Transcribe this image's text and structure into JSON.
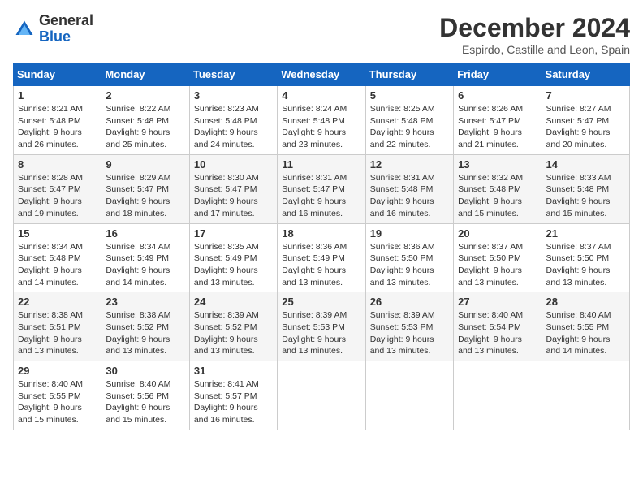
{
  "header": {
    "logo_general": "General",
    "logo_blue": "Blue",
    "month_title": "December 2024",
    "location": "Espirdo, Castille and Leon, Spain"
  },
  "columns": [
    "Sunday",
    "Monday",
    "Tuesday",
    "Wednesday",
    "Thursday",
    "Friday",
    "Saturday"
  ],
  "weeks": [
    [
      {
        "day": "1",
        "sunrise": "Sunrise: 8:21 AM",
        "sunset": "Sunset: 5:48 PM",
        "daylight": "Daylight: 9 hours and 26 minutes."
      },
      {
        "day": "2",
        "sunrise": "Sunrise: 8:22 AM",
        "sunset": "Sunset: 5:48 PM",
        "daylight": "Daylight: 9 hours and 25 minutes."
      },
      {
        "day": "3",
        "sunrise": "Sunrise: 8:23 AM",
        "sunset": "Sunset: 5:48 PM",
        "daylight": "Daylight: 9 hours and 24 minutes."
      },
      {
        "day": "4",
        "sunrise": "Sunrise: 8:24 AM",
        "sunset": "Sunset: 5:48 PM",
        "daylight": "Daylight: 9 hours and 23 minutes."
      },
      {
        "day": "5",
        "sunrise": "Sunrise: 8:25 AM",
        "sunset": "Sunset: 5:48 PM",
        "daylight": "Daylight: 9 hours and 22 minutes."
      },
      {
        "day": "6",
        "sunrise": "Sunrise: 8:26 AM",
        "sunset": "Sunset: 5:47 PM",
        "daylight": "Daylight: 9 hours and 21 minutes."
      },
      {
        "day": "7",
        "sunrise": "Sunrise: 8:27 AM",
        "sunset": "Sunset: 5:47 PM",
        "daylight": "Daylight: 9 hours and 20 minutes."
      }
    ],
    [
      {
        "day": "8",
        "sunrise": "Sunrise: 8:28 AM",
        "sunset": "Sunset: 5:47 PM",
        "daylight": "Daylight: 9 hours and 19 minutes."
      },
      {
        "day": "9",
        "sunrise": "Sunrise: 8:29 AM",
        "sunset": "Sunset: 5:47 PM",
        "daylight": "Daylight: 9 hours and 18 minutes."
      },
      {
        "day": "10",
        "sunrise": "Sunrise: 8:30 AM",
        "sunset": "Sunset: 5:47 PM",
        "daylight": "Daylight: 9 hours and 17 minutes."
      },
      {
        "day": "11",
        "sunrise": "Sunrise: 8:31 AM",
        "sunset": "Sunset: 5:47 PM",
        "daylight": "Daylight: 9 hours and 16 minutes."
      },
      {
        "day": "12",
        "sunrise": "Sunrise: 8:31 AM",
        "sunset": "Sunset: 5:48 PM",
        "daylight": "Daylight: 9 hours and 16 minutes."
      },
      {
        "day": "13",
        "sunrise": "Sunrise: 8:32 AM",
        "sunset": "Sunset: 5:48 PM",
        "daylight": "Daylight: 9 hours and 15 minutes."
      },
      {
        "day": "14",
        "sunrise": "Sunrise: 8:33 AM",
        "sunset": "Sunset: 5:48 PM",
        "daylight": "Daylight: 9 hours and 15 minutes."
      }
    ],
    [
      {
        "day": "15",
        "sunrise": "Sunrise: 8:34 AM",
        "sunset": "Sunset: 5:48 PM",
        "daylight": "Daylight: 9 hours and 14 minutes."
      },
      {
        "day": "16",
        "sunrise": "Sunrise: 8:34 AM",
        "sunset": "Sunset: 5:49 PM",
        "daylight": "Daylight: 9 hours and 14 minutes."
      },
      {
        "day": "17",
        "sunrise": "Sunrise: 8:35 AM",
        "sunset": "Sunset: 5:49 PM",
        "daylight": "Daylight: 9 hours and 13 minutes."
      },
      {
        "day": "18",
        "sunrise": "Sunrise: 8:36 AM",
        "sunset": "Sunset: 5:49 PM",
        "daylight": "Daylight: 9 hours and 13 minutes."
      },
      {
        "day": "19",
        "sunrise": "Sunrise: 8:36 AM",
        "sunset": "Sunset: 5:50 PM",
        "daylight": "Daylight: 9 hours and 13 minutes."
      },
      {
        "day": "20",
        "sunrise": "Sunrise: 8:37 AM",
        "sunset": "Sunset: 5:50 PM",
        "daylight": "Daylight: 9 hours and 13 minutes."
      },
      {
        "day": "21",
        "sunrise": "Sunrise: 8:37 AM",
        "sunset": "Sunset: 5:50 PM",
        "daylight": "Daylight: 9 hours and 13 minutes."
      }
    ],
    [
      {
        "day": "22",
        "sunrise": "Sunrise: 8:38 AM",
        "sunset": "Sunset: 5:51 PM",
        "daylight": "Daylight: 9 hours and 13 minutes."
      },
      {
        "day": "23",
        "sunrise": "Sunrise: 8:38 AM",
        "sunset": "Sunset: 5:52 PM",
        "daylight": "Daylight: 9 hours and 13 minutes."
      },
      {
        "day": "24",
        "sunrise": "Sunrise: 8:39 AM",
        "sunset": "Sunset: 5:52 PM",
        "daylight": "Daylight: 9 hours and 13 minutes."
      },
      {
        "day": "25",
        "sunrise": "Sunrise: 8:39 AM",
        "sunset": "Sunset: 5:53 PM",
        "daylight": "Daylight: 9 hours and 13 minutes."
      },
      {
        "day": "26",
        "sunrise": "Sunrise: 8:39 AM",
        "sunset": "Sunset: 5:53 PM",
        "daylight": "Daylight: 9 hours and 13 minutes."
      },
      {
        "day": "27",
        "sunrise": "Sunrise: 8:40 AM",
        "sunset": "Sunset: 5:54 PM",
        "daylight": "Daylight: 9 hours and 13 minutes."
      },
      {
        "day": "28",
        "sunrise": "Sunrise: 8:40 AM",
        "sunset": "Sunset: 5:55 PM",
        "daylight": "Daylight: 9 hours and 14 minutes."
      }
    ],
    [
      {
        "day": "29",
        "sunrise": "Sunrise: 8:40 AM",
        "sunset": "Sunset: 5:55 PM",
        "daylight": "Daylight: 9 hours and 15 minutes."
      },
      {
        "day": "30",
        "sunrise": "Sunrise: 8:40 AM",
        "sunset": "Sunset: 5:56 PM",
        "daylight": "Daylight: 9 hours and 15 minutes."
      },
      {
        "day": "31",
        "sunrise": "Sunrise: 8:41 AM",
        "sunset": "Sunset: 5:57 PM",
        "daylight": "Daylight: 9 hours and 16 minutes."
      },
      null,
      null,
      null,
      null
    ]
  ]
}
